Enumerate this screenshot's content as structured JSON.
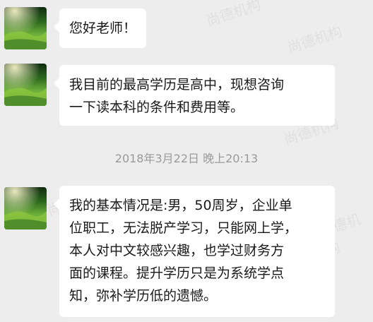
{
  "messages": [
    {
      "text": "您好老师！"
    },
    {
      "text": "我目前的最高学历是高中，现想咨询\n一下读本科的条件和费用等。"
    },
    {
      "text": "我的基本情况是:男，50周岁，企业单\n位职工，无法脱产学习，只能网上学，\n本人对中文较感兴趣，也学过财务方\n面的课程。提升学历只是为系统学点\n知，弥补学历低的遗憾。"
    }
  ],
  "timestamp": "2018年3月22日 晚上20:13",
  "watermark": "尚德机构"
}
